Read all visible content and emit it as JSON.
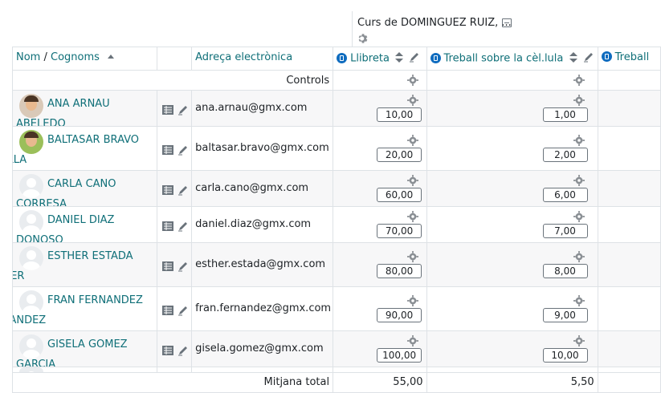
{
  "course": {
    "title": "Curs de DOMINGUEZ RUIZ, ..."
  },
  "headers": {
    "name_first": "Nom",
    "name_sep": " / ",
    "name_last": "Cognoms",
    "email": "Adreça electrònica",
    "col1": "Llibreta",
    "col2": "Treball sobre la cèl.lula",
    "col3": "Treball"
  },
  "controls_label": "Controls",
  "students": [
    {
      "name_line1": "ANA ARNAU ABELEDO",
      "name_line2": "",
      "email": "ana.arnau@gmx.com",
      "grade1": "10,00",
      "grade2": "1,00",
      "avatar": "photo-girl"
    },
    {
      "name_line1": "BALTASAR BRAVO",
      "name_line2": "BONILLA",
      "email": "baltasar.bravo@gmx.com",
      "grade1": "20,00",
      "grade2": "2,00",
      "avatar": "photo-boy"
    },
    {
      "name_line1": "CARLA CANO CORRESA",
      "name_line2": "",
      "email": "carla.cano@gmx.com",
      "grade1": "60,00",
      "grade2": "6,00",
      "avatar": "generic"
    },
    {
      "name_line1": "DANIEL DIAZ DONOSO",
      "name_line2": "",
      "email": "daniel.diaz@gmx.com",
      "grade1": "70,00",
      "grade2": "7,00",
      "avatar": "generic"
    },
    {
      "name_line1": "ESTHER ESTADA",
      "name_line2": "ESQUER",
      "email": "esther.estada@gmx.com",
      "grade1": "80,00",
      "grade2": "8,00",
      "avatar": "generic"
    },
    {
      "name_line1": "FRAN FERNANDEZ",
      "name_line2": "FERNANDEZ",
      "email": "fran.fernandez@gmx.com",
      "grade1": "90,00",
      "grade2": "9,00",
      "avatar": "generic"
    },
    {
      "name_line1": "GISELA GOMEZ GARCIA",
      "name_line2": "",
      "email": "gisela.gomez@gmx.com",
      "grade1": "100,00",
      "grade2": "10,00",
      "avatar": "generic"
    }
  ],
  "footer": {
    "label": "Mitjana total",
    "avg1": "55,00",
    "avg2": "5,50"
  },
  "colors": {
    "link": "#0f6f78",
    "border": "#dee2e6",
    "stripe": "#f7f7f8",
    "calc_icon": "#0f6cbf"
  }
}
